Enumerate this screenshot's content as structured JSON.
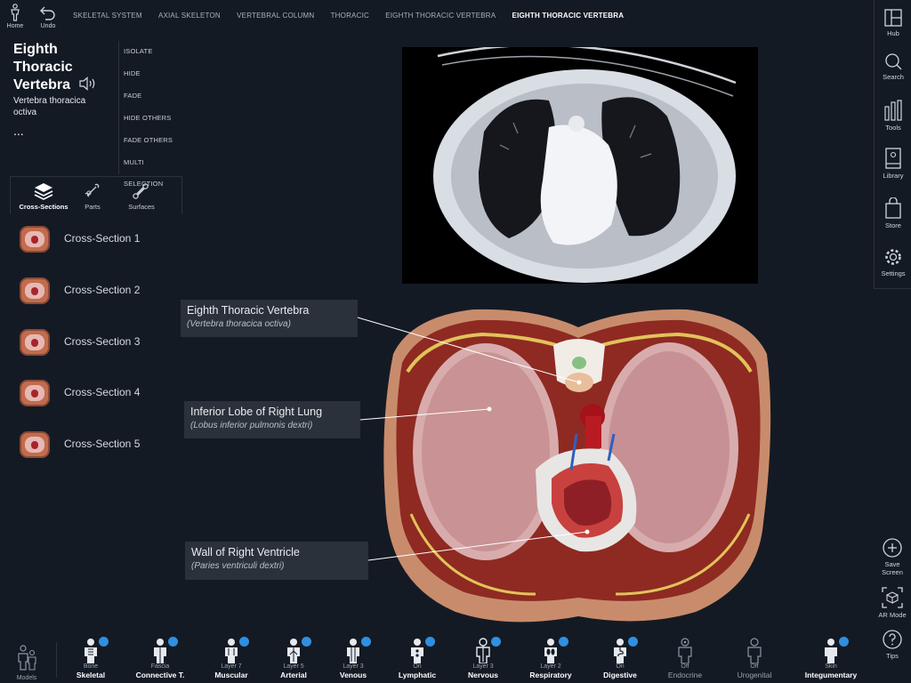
{
  "topbar": {
    "home_label": "Home",
    "undo_label": "Undo",
    "breadcrumbs": [
      "SKELETAL SYSTEM",
      "AXIAL SKELETON",
      "VERTEBRAL COLUMN",
      "THORACIC",
      "EIGHTH THORACIC VERTEBRA",
      "EIGHTH THORACIC VERTEBRA"
    ]
  },
  "structure": {
    "title_line1": "Eighth",
    "title_line2": "Thoracic",
    "title_line3": "Vertebra",
    "latin_line1": "Vertebra thoracica",
    "latin_line2": "octiva",
    "more": "..."
  },
  "actions": [
    "ISOLATE",
    "HIDE",
    "FADE",
    "HIDE OTHERS",
    "FADE OTHERS",
    "MULTI SELECTION"
  ],
  "tabs": [
    {
      "label": "Cross-Sections",
      "icon": "layers-icon",
      "active": true
    },
    {
      "label": "Parts",
      "icon": "bone-parts-icon",
      "active": false
    },
    {
      "label": "Surfaces",
      "icon": "bone-surfaces-icon",
      "active": false
    }
  ],
  "cross_sections": [
    "Cross-Section 1",
    "Cross-Section 2",
    "Cross-Section 3",
    "Cross-Section 4",
    "Cross-Section 5"
  ],
  "right_sidebar": [
    "Hub",
    "Search",
    "Tools",
    "Library",
    "Store",
    "Settings"
  ],
  "right_bottom": {
    "save_line1": "Save",
    "save_line2": "Screen",
    "ar_label": "AR Mode",
    "tips_label": "Tips"
  },
  "labels": [
    {
      "name": "Eighth Thoracic Vertebra",
      "latin": "(Vertebra thoracica octiva)"
    },
    {
      "name": "Inferior Lobe of Right Lung",
      "latin": "(Lobus inferior pulmonis dextri)"
    },
    {
      "name": "Wall of Right Ventricle",
      "latin": "(Paries ventriculi dextri)"
    }
  ],
  "models_label": "Models",
  "systems": [
    {
      "sub": "Bone",
      "main": "Skeletal",
      "state": "on"
    },
    {
      "sub": "Fascia",
      "main": "Connective T.",
      "state": "on"
    },
    {
      "sub": "Layer 7",
      "main": "Muscular",
      "state": "on"
    },
    {
      "sub": "Layer 5",
      "main": "Arterial",
      "state": "on"
    },
    {
      "sub": "Layer 3",
      "main": "Venous",
      "state": "on"
    },
    {
      "sub": "On",
      "main": "Lymphatic",
      "state": "on"
    },
    {
      "sub": "Layer 3",
      "main": "Nervous",
      "state": "on"
    },
    {
      "sub": "Layer 2",
      "main": "Respiratory",
      "state": "on"
    },
    {
      "sub": "On",
      "main": "Digestive",
      "state": "on"
    },
    {
      "sub": "Off",
      "main": "Endocrine",
      "state": "off"
    },
    {
      "sub": "Off",
      "main": "Urogenital",
      "state": "off"
    },
    {
      "sub": "Skin",
      "main": "Integumentary",
      "state": "on"
    }
  ],
  "colors": {
    "background": "#141a24",
    "panel": "#2b313b",
    "accent": "#2f8fe0"
  }
}
